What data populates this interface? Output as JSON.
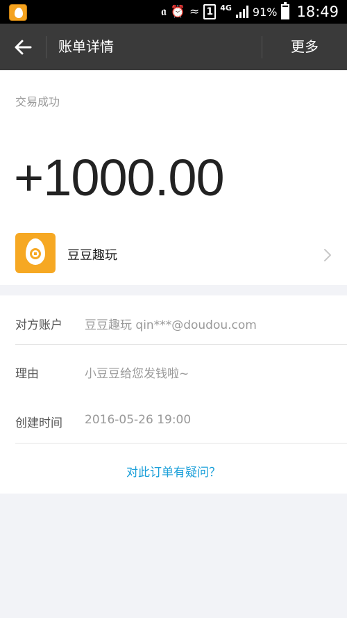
{
  "status_bar": {
    "app_icon": "doudou-app-icon",
    "network": "4G",
    "battery_percent": "91%",
    "battery_level": 0.91,
    "time": "18:49"
  },
  "header": {
    "back_icon": "arrow-left-icon",
    "title": "账单详情",
    "more_label": "更多"
  },
  "transaction": {
    "status": "交易成功",
    "amount": "+1000.00",
    "merchant": {
      "name": "豆豆趣玩",
      "logo_icon": "doudou-logo-icon",
      "chevron_icon": "chevron-right-icon"
    }
  },
  "details": [
    {
      "label": "对方账户",
      "value": "豆豆趣玩 qin***@doudou.com"
    },
    {
      "label": "理由",
      "value": "小豆豆给您发钱啦~"
    },
    {
      "label": "创建时间",
      "value": "2016-05-26 19:00"
    }
  ],
  "question_link": "对此订单有疑问？",
  "colors": {
    "header_bg": "#3a3a3a",
    "brand_orange": "#f6a823",
    "link_blue": "#1a9fd9"
  }
}
